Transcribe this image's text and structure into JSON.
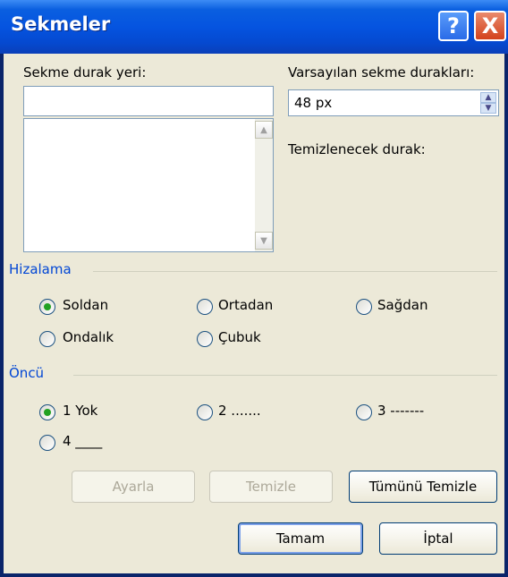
{
  "title": "Sekmeler",
  "title_buttons": {
    "help": "?",
    "close": "X"
  },
  "tab_stop": {
    "label": "Sekme durak yeri:",
    "value": ""
  },
  "default_stops": {
    "label": "Varsayılan sekme durakları:",
    "value": "48 px"
  },
  "clear_label": "Temizlenecek durak:",
  "alignment": {
    "title": "Hizalama",
    "options": [
      "Soldan",
      "Ortadan",
      "Sağdan",
      "Ondalık",
      "Çubuk"
    ],
    "selected": "Soldan"
  },
  "leader": {
    "title": "Öncü",
    "options": [
      "1 Yok",
      "2 .......",
      "3 -------",
      "4 ____"
    ],
    "selected": "1 Yok"
  },
  "buttons": {
    "set": "Ayarla",
    "clear": "Temizle",
    "clear_all": "Tümünü Temizle",
    "ok": "Tamam",
    "cancel": "İptal"
  }
}
